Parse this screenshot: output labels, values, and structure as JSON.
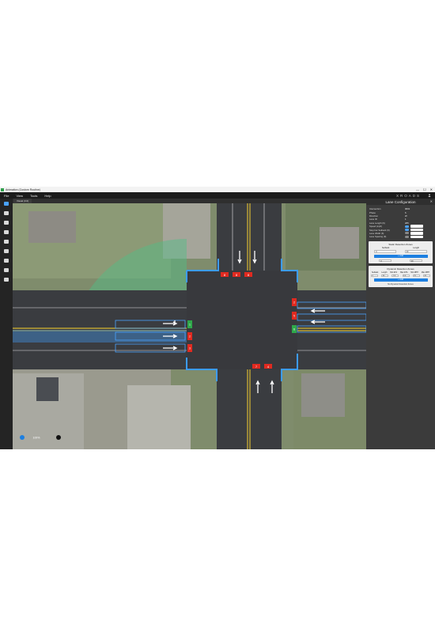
{
  "window": {
    "title": "Animation (Custom Routine)",
    "controls": [
      "—",
      "☐",
      "✕"
    ]
  },
  "menu": {
    "items": [
      "File",
      "View",
      "Tools",
      "Help"
    ],
    "brand": "XROADS"
  },
  "sidebar": {
    "buttons": [
      {
        "icon": "back-arrow-icon",
        "active": true
      },
      {
        "icon": "list-icon"
      },
      {
        "icon": "traffic-signal-icon"
      },
      {
        "icon": "chart-line-icon"
      },
      {
        "icon": "wifi-icon"
      },
      {
        "icon": "storage-icon"
      },
      {
        "icon": "chat-icon"
      },
      {
        "icon": "vehicle-icon"
      },
      {
        "icon": "clipboard-icon"
      }
    ]
  },
  "tab": {
    "label": "Visual (3.0)"
  },
  "panel": {
    "title": "Lane Configuration",
    "fields": [
      {
        "label": "Intersection",
        "value": "0001"
      },
      {
        "label": "Phase",
        "value": "6"
      },
      {
        "label": "Direction",
        "value": "W"
      },
      {
        "label": "Lane ID",
        "value": "1"
      },
      {
        "label": "Lane Length (ft)",
        "value": "265"
      },
      {
        "label": "Speed (mph)",
        "value": ""
      },
      {
        "label": "Stop bar Setback (ft)",
        "value": ""
      },
      {
        "label": "Lane Width (ft)",
        "value": ""
      },
      {
        "label": "Lane Spacing (ft)",
        "value": ""
      }
    ],
    "static_zones": {
      "title": "Static Detection Zones",
      "col_setback": "Setback",
      "col_length": "Length",
      "setback_value": "0",
      "length_value": "40",
      "add_label": "+ Add",
      "extra_a": "0",
      "extra_b": "40"
    },
    "dynamic_zones": {
      "title": "Dynamic Detection Zones",
      "columns": [
        "Setback",
        "Length",
        "Min ETA",
        "Max ETA",
        "Min MPH",
        "Max MPH"
      ],
      "values": [
        "0",
        "90",
        "2.8",
        "5.6",
        "25",
        "45"
      ],
      "add_label": "+ Add",
      "note": "No Dynamic Detection Zones"
    }
  },
  "map": {
    "signal_heads": {
      "north": [
        "8",
        "8",
        "8"
      ],
      "south": [
        "7",
        "4"
      ],
      "east": [
        "2",
        "5",
        "6"
      ],
      "west": [
        "1",
        "2",
        "3"
      ]
    },
    "zoom_label": "100%"
  }
}
